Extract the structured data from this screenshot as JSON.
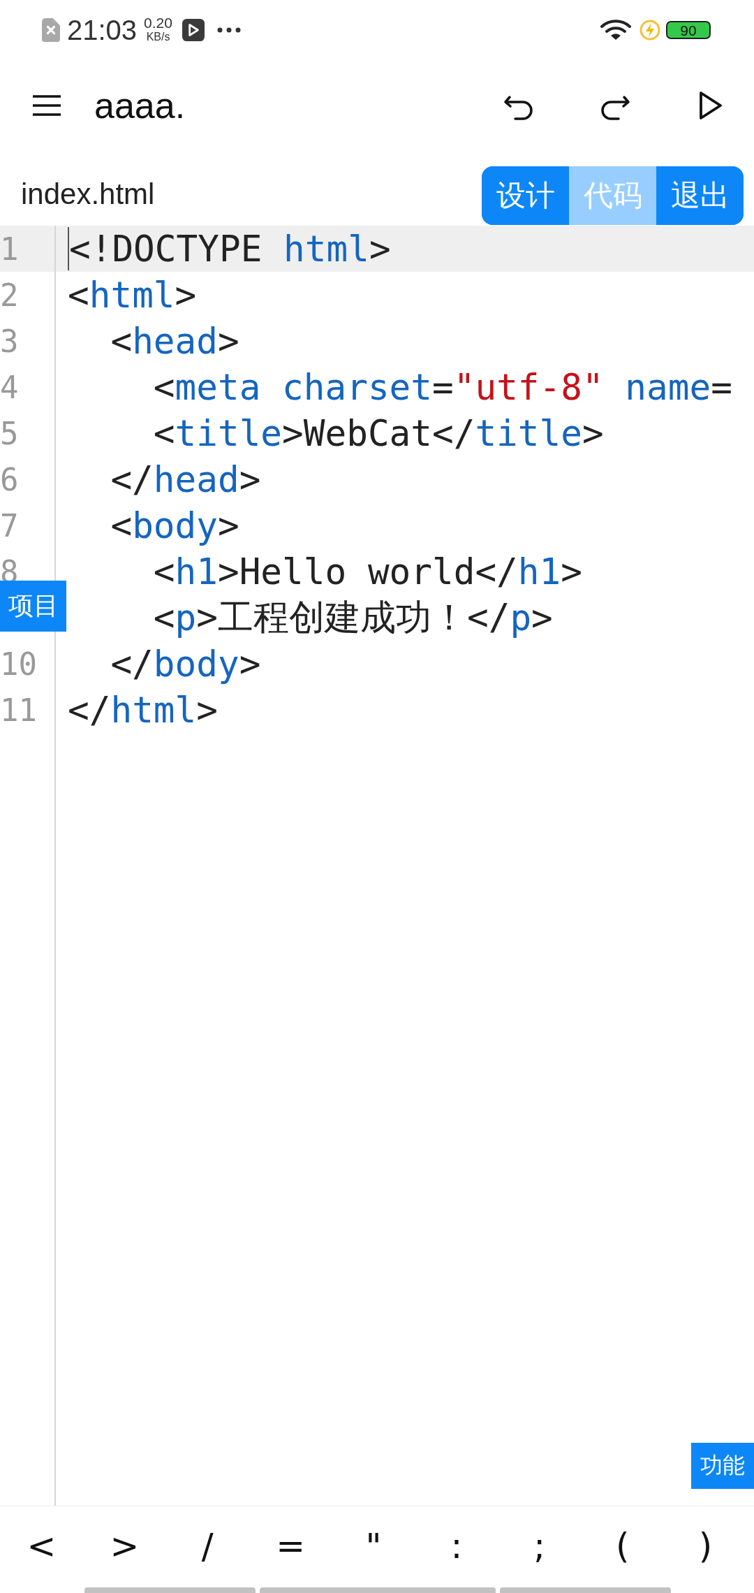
{
  "status_bar": {
    "time": "21:03",
    "speed_value": "0.20",
    "speed_unit": "KB/s",
    "battery": "90"
  },
  "toolbar": {
    "title": "aaaa."
  },
  "file_bar": {
    "filename": "index.html",
    "tabs": [
      {
        "label": "设计",
        "selected": false
      },
      {
        "label": "代码",
        "selected": true
      },
      {
        "label": "退出",
        "selected": false
      }
    ]
  },
  "editor": {
    "lines": [
      {
        "number": "1",
        "current": true,
        "tokens": [
          {
            "kind": "punct",
            "text": "<!DOCTYPE "
          },
          {
            "kind": "tag",
            "text": "html"
          },
          {
            "kind": "punct",
            "text": ">"
          }
        ]
      },
      {
        "number": "2",
        "current": false,
        "tokens": [
          {
            "kind": "punct",
            "text": "<"
          },
          {
            "kind": "tag",
            "text": "html"
          },
          {
            "kind": "punct",
            "text": ">"
          }
        ]
      },
      {
        "number": "3",
        "current": false,
        "tokens": [
          {
            "kind": "punct",
            "text": "  <"
          },
          {
            "kind": "tag",
            "text": "head"
          },
          {
            "kind": "punct",
            "text": ">"
          }
        ]
      },
      {
        "number": "4",
        "current": false,
        "tokens": [
          {
            "kind": "punct",
            "text": "    <"
          },
          {
            "kind": "tag",
            "text": "meta"
          },
          {
            "kind": "attr",
            "text": " charset"
          },
          {
            "kind": "punct",
            "text": "="
          },
          {
            "kind": "string",
            "text": "\"utf-8\""
          },
          {
            "kind": "attr",
            "text": " name"
          },
          {
            "kind": "punct",
            "text": "="
          }
        ]
      },
      {
        "number": "5",
        "current": false,
        "tokens": [
          {
            "kind": "punct",
            "text": "    <"
          },
          {
            "kind": "tag",
            "text": "title"
          },
          {
            "kind": "punct",
            "text": ">WebCat</"
          },
          {
            "kind": "tag",
            "text": "title"
          },
          {
            "kind": "punct",
            "text": ">"
          }
        ]
      },
      {
        "number": "6",
        "current": false,
        "tokens": [
          {
            "kind": "punct",
            "text": "  </"
          },
          {
            "kind": "tag",
            "text": "head"
          },
          {
            "kind": "punct",
            "text": ">"
          }
        ]
      },
      {
        "number": "7",
        "current": false,
        "tokens": [
          {
            "kind": "punct",
            "text": "  <"
          },
          {
            "kind": "tag",
            "text": "body"
          },
          {
            "kind": "punct",
            "text": ">"
          }
        ]
      },
      {
        "number": "8",
        "current": false,
        "tokens": [
          {
            "kind": "punct",
            "text": "    <"
          },
          {
            "kind": "tag",
            "text": "h1"
          },
          {
            "kind": "punct",
            "text": ">Hello world</"
          },
          {
            "kind": "tag",
            "text": "h1"
          },
          {
            "kind": "punct",
            "text": ">"
          }
        ]
      },
      {
        "current": false,
        "tokens": [
          {
            "kind": "punct",
            "text": "    <"
          },
          {
            "kind": "tag",
            "text": "p"
          },
          {
            "kind": "punct",
            "text": ">工程创建成功！</"
          },
          {
            "kind": "tag",
            "text": "p"
          },
          {
            "kind": "punct",
            "text": ">"
          }
        ]
      },
      {
        "number": "10",
        "current": false,
        "tokens": [
          {
            "kind": "punct",
            "text": "  </"
          },
          {
            "kind": "tag",
            "text": "body"
          },
          {
            "kind": "punct",
            "text": ">"
          }
        ]
      },
      {
        "number": "11",
        "current": false,
        "tokens": [
          {
            "kind": "punct",
            "text": "</"
          },
          {
            "kind": "tag",
            "text": "html"
          },
          {
            "kind": "punct",
            "text": ">"
          }
        ]
      }
    ],
    "project_button": "项目",
    "function_button": "功能"
  },
  "key_bar": {
    "keys": [
      "<",
      ">",
      "/",
      "=",
      "\"",
      ":",
      ";",
      "(",
      ")"
    ]
  }
}
